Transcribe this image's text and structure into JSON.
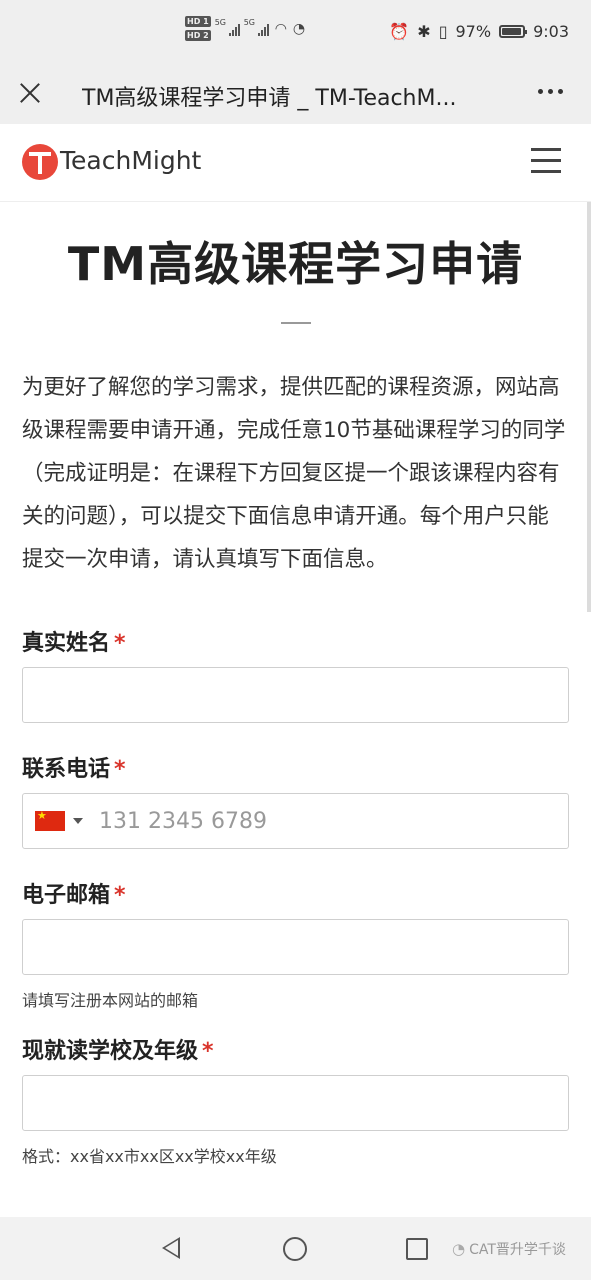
{
  "status_bar": {
    "hd_badges": [
      "HD 1",
      "HD 2"
    ],
    "network": [
      "5G",
      "5G"
    ],
    "battery_percent": "97%",
    "battery_level": 0.97,
    "time": "9:03"
  },
  "title_bar": {
    "title": "TM高级课程学习申请 _ TM-TeachM..."
  },
  "site": {
    "logo_text": "TeachMight",
    "brand_color": "#e8473a"
  },
  "page": {
    "title": "TM高级课程学习申请",
    "intro": "为更好了解您的学习需求，提供匹配的课程资源，网站高级课程需要申请开通，完成任意10节基础课程学习的同学（完成证明是：在课程下方回复区提一个跟该课程内容有关的问题），可以提交下面信息申请开通。每个用户只能提交一次申请，请认真填写下面信息。"
  },
  "form": {
    "required_mark": "*",
    "name": {
      "label": "真实姓名",
      "value": ""
    },
    "phone": {
      "label": "联系电话",
      "placeholder": "131 2345 6789",
      "country_icon": "cn-flag-icon"
    },
    "email": {
      "label": "电子邮箱",
      "value": "",
      "help": "请填写注册本网站的邮箱"
    },
    "school": {
      "label": "现就读学校及年级",
      "value": "",
      "help": "格式：xx省xx市xx区xx学校xx年级"
    }
  },
  "watermark": {
    "text": "CAT晋升学千谈"
  }
}
